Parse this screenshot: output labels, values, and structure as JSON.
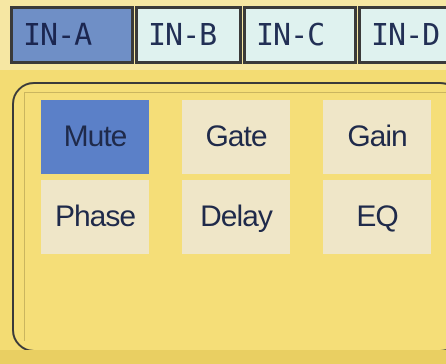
{
  "tabs": [
    {
      "label": "IN-A",
      "active": true
    },
    {
      "label": "IN-B",
      "active": false
    },
    {
      "label": "IN-C",
      "active": false
    },
    {
      "label": "IN-D",
      "active": false
    }
  ],
  "functions": [
    {
      "label": "Mute",
      "active": true
    },
    {
      "label": "Gate",
      "active": false
    },
    {
      "label": "Gain",
      "active": false
    },
    {
      "label": "Phase",
      "active": false
    },
    {
      "label": "Delay",
      "active": false
    },
    {
      "label": "EQ",
      "active": false
    }
  ],
  "colors": {
    "screen_background": "#f3dc73",
    "tab_inactive": "#dff2ef",
    "tab_active": "#6f8fc6",
    "button_inactive": "#efe6c8",
    "button_active": "#5b80c8",
    "text": "#1f2a4a",
    "border": "#3a3a3a"
  }
}
